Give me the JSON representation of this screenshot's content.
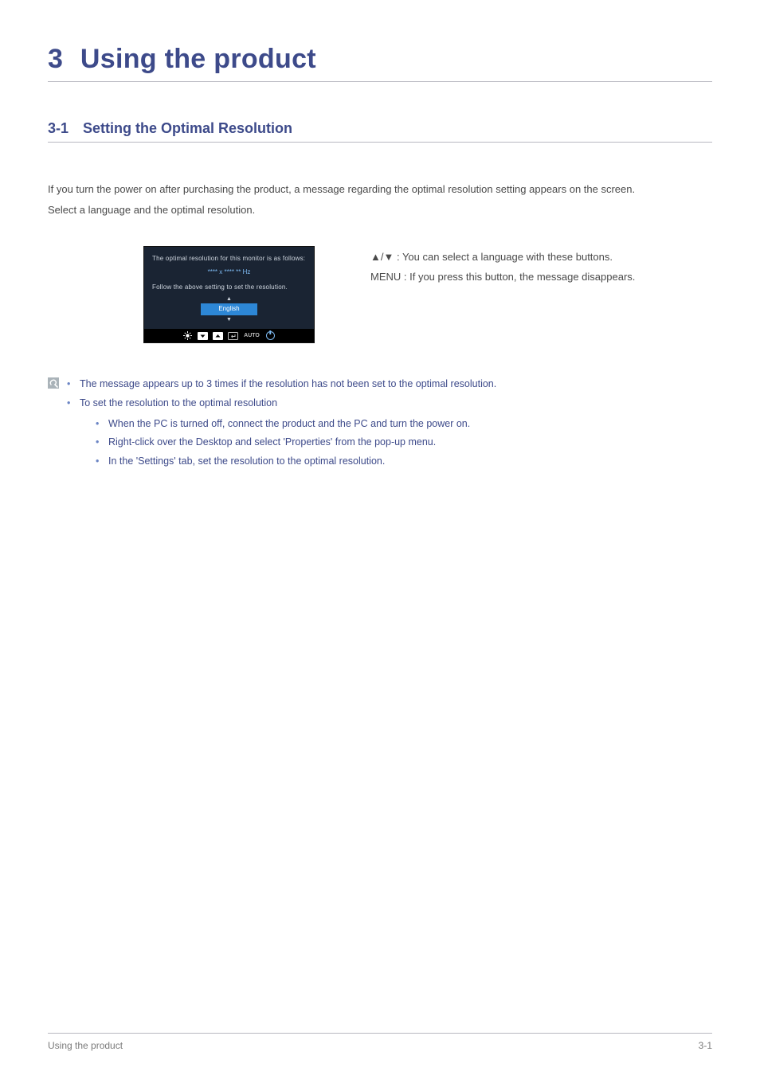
{
  "chapter": {
    "number": "3",
    "title": "Using the product"
  },
  "section": {
    "number": "3-1",
    "title": "Setting the Optimal Resolution"
  },
  "intro": {
    "p1": "If you turn the power on after purchasing the product, a message regarding the optimal resolution setting appears on the screen.",
    "p2": "Select a language and the optimal resolution."
  },
  "osd": {
    "line1": "The optimal resolution for this monitor is as follows:",
    "resolution": "**** x **** ** Hz",
    "line2": "Follow the above setting to set the resolution.",
    "language": "English",
    "bar_auto": "AUTO"
  },
  "descriptions": {
    "d1": "▲/▼ : You can select a language with these buttons.",
    "d2": "MENU : If you press this button, the message disappears."
  },
  "notes": {
    "n1": "The message appears up to 3 times if the resolution has not been set to the optimal resolution.",
    "n2": "To set the resolution to the optimal resolution",
    "n2a": "When the PC is turned off, connect the product and the PC and turn the power on.",
    "n2b": "Right-click over the Desktop and select 'Properties' from the pop-up menu.",
    "n2c": "In the 'Settings' tab, set the resolution to the optimal resolution."
  },
  "footer": {
    "left": "Using the product",
    "right": "3-1"
  }
}
